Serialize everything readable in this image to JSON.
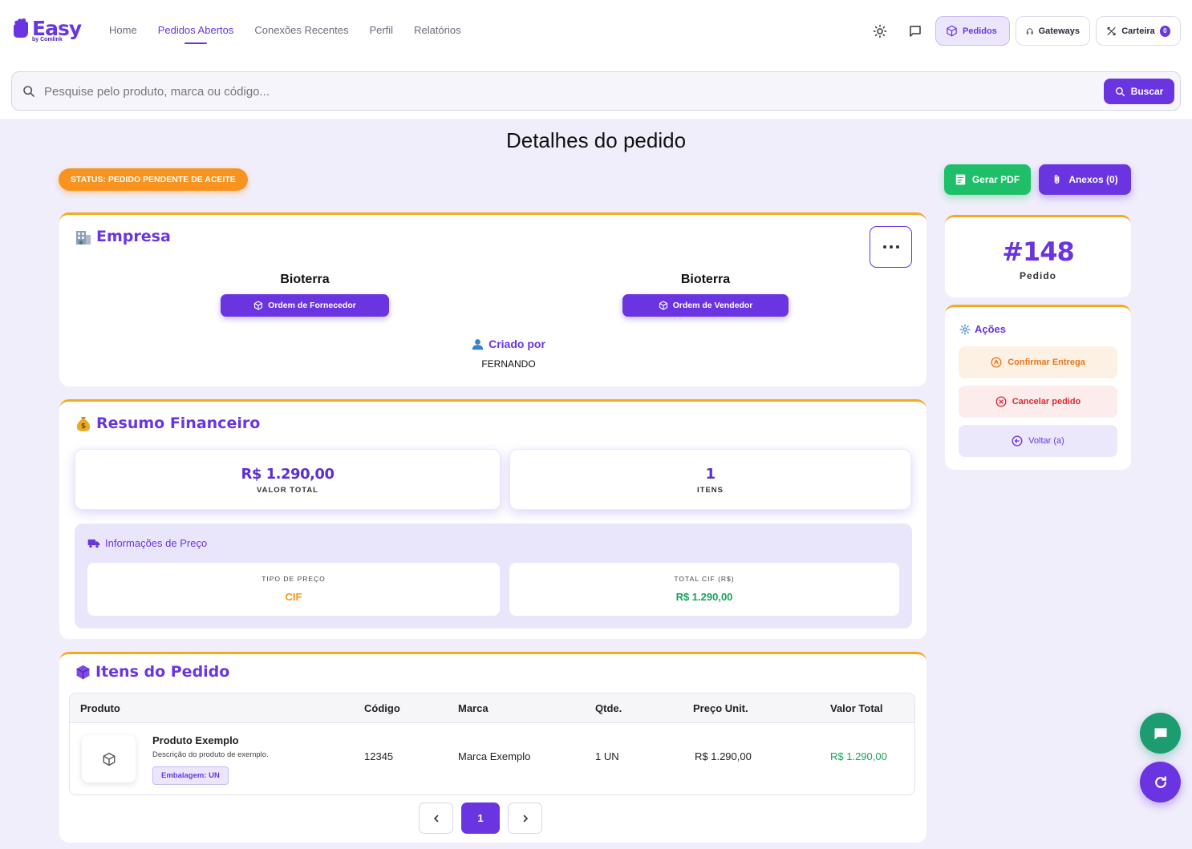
{
  "header": {
    "logo_text": "Easy",
    "logo_sub": "by Comlink",
    "nav": [
      {
        "label": "Home"
      },
      {
        "label": "Pedidos Abertos"
      },
      {
        "label": "Conexões Recentes"
      },
      {
        "label": "Perfil"
      },
      {
        "label": "Relatórios"
      }
    ],
    "btn_pedidos": "Pedidos",
    "btn_gateways": "Gateways",
    "btn_carteira": "Carteira",
    "carteira_badge": "0"
  },
  "search": {
    "placeholder": "Pesquise pelo produto, marca ou código...",
    "button": "Buscar"
  },
  "page": {
    "title": "Detalhes do pedido",
    "status": "STATUS: PEDIDO PENDENTE DE ACEITE",
    "btn_pdf": "Gerar PDF",
    "btn_anexos": "Anexos (0)"
  },
  "empresa": {
    "title": "Empresa",
    "supplier_name": "Bioterra",
    "supplier_button": "Ordem de Fornecedor",
    "seller_name": "Bioterra",
    "seller_button": "Ordem de Vendedor",
    "created_label": "Criado por",
    "created_name": "FERNANDO"
  },
  "resumo": {
    "title": "Resumo Financeiro",
    "total_value": "R$ 1.290,00",
    "total_label": "VALOR TOTAL",
    "items_value": "1",
    "items_label": "ITENS",
    "price_title": "Informações de Preço",
    "price_type_label": "TIPO DE PREÇO",
    "price_type_value": "CIF",
    "total_cif_label": "TOTAL CIF (R$)",
    "total_cif_value": "R$ 1.290,00"
  },
  "itens": {
    "title": "Itens do Pedido",
    "columns": [
      "Produto",
      "Código",
      "Marca",
      "Qtde.",
      "Preço Unit.",
      "Valor Total"
    ],
    "rows": [
      {
        "name": "Produto Exemplo",
        "description": "Descrição do produto de exemplo.",
        "packaging": "Embalagem: UN",
        "code": "12345",
        "brand": "Marca Exemplo",
        "qty": "1 UN",
        "unit_price": "R$ 1.290,00",
        "total": "R$ 1.290,00"
      }
    ],
    "current_page": "1"
  },
  "order": {
    "number": "#148",
    "label": "Pedido"
  },
  "acoes": {
    "title": "Ações",
    "confirm": "Confirmar Entrega",
    "cancel": "Cancelar pedido",
    "back": "Voltar (a)"
  },
  "colors": {
    "accent": "#6a35e0",
    "status": "#f7931e",
    "success": "#1fbf6a",
    "danger": "#dc2b34"
  }
}
